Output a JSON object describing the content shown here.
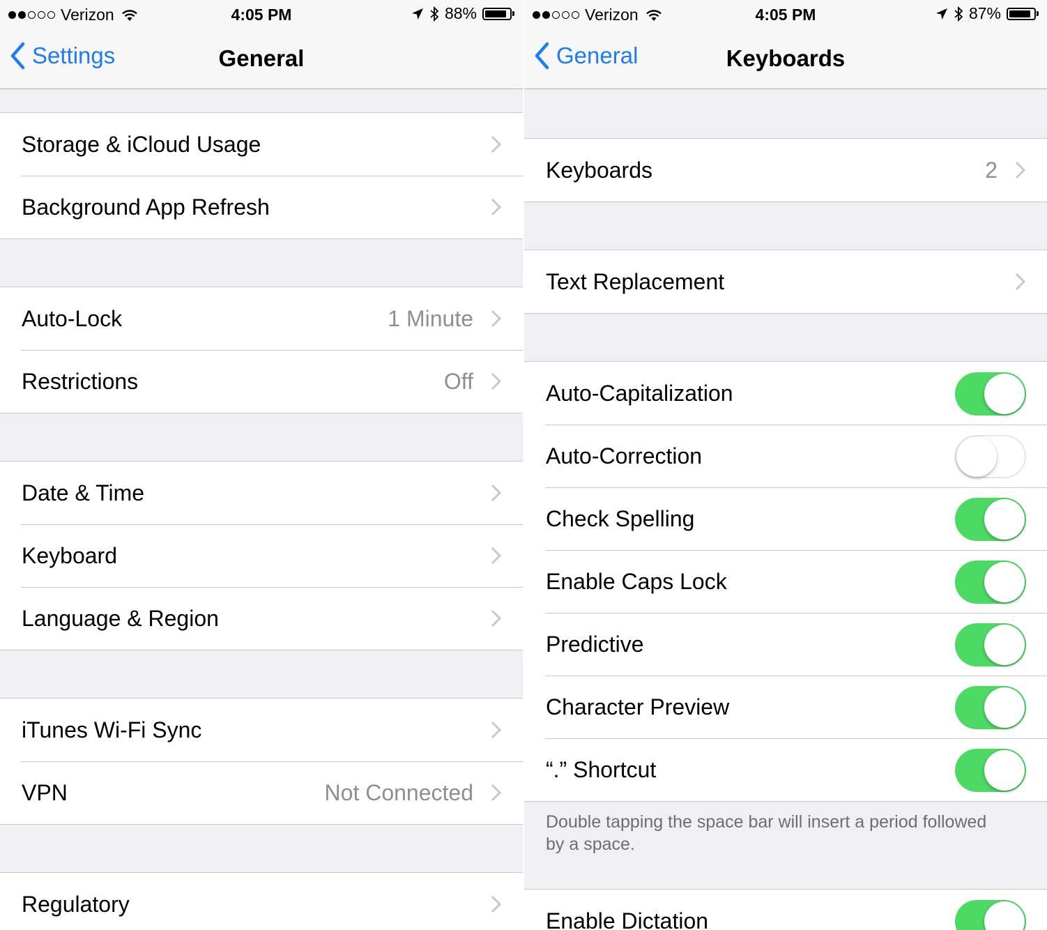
{
  "left": {
    "status": {
      "carrier": "Verizon",
      "time": "4:05 PM",
      "battery": "88%",
      "battery_level": 0.88
    },
    "nav": {
      "back_label": "Settings",
      "title": "General"
    },
    "groups": [
      {
        "rows": [
          {
            "label": "Storage & iCloud Usage"
          },
          {
            "label": "Background App Refresh"
          }
        ]
      },
      {
        "rows": [
          {
            "label": "Auto-Lock",
            "value": "1 Minute"
          },
          {
            "label": "Restrictions",
            "value": "Off"
          }
        ]
      },
      {
        "rows": [
          {
            "label": "Date & Time"
          },
          {
            "label": "Keyboard"
          },
          {
            "label": "Language & Region"
          }
        ]
      },
      {
        "rows": [
          {
            "label": "iTunes Wi-Fi Sync"
          },
          {
            "label": "VPN",
            "value": "Not Connected"
          }
        ]
      },
      {
        "rows": [
          {
            "label": "Regulatory"
          }
        ]
      }
    ]
  },
  "right": {
    "status": {
      "carrier": "Verizon",
      "time": "4:05 PM",
      "battery": "87%",
      "battery_level": 0.87
    },
    "nav": {
      "back_label": "General",
      "title": "Keyboards"
    },
    "groups": [
      {
        "rows": [
          {
            "label": "Keyboards",
            "value": "2"
          }
        ]
      },
      {
        "rows": [
          {
            "label": "Text Replacement"
          }
        ]
      },
      {
        "rows": [
          {
            "label": "Auto-Capitalization",
            "toggle": true
          },
          {
            "label": "Auto-Correction",
            "toggle": false
          },
          {
            "label": "Check Spelling",
            "toggle": true
          },
          {
            "label": "Enable Caps Lock",
            "toggle": true
          },
          {
            "label": "Predictive",
            "toggle": true
          },
          {
            "label": "Character Preview",
            "toggle": true
          },
          {
            "label": "“.” Shortcut",
            "toggle": true
          }
        ]
      },
      {
        "rows": [
          {
            "label": "Enable Dictation",
            "toggle": true
          }
        ]
      }
    ],
    "footer_note": "Double tapping the space bar will insert a period followed by a space."
  },
  "colors": {
    "accent": "#1d7cf4",
    "toggle_on": "#4cd964",
    "background": "#efeff4",
    "secondary_text": "#8e8e93"
  }
}
